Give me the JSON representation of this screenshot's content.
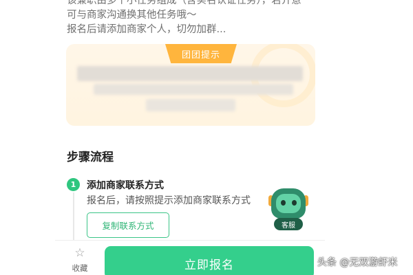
{
  "description": {
    "lines": [
      "该兼职由多个小任务组成（含实名认证任务），若介意",
      "可与商家沟通换其他任务哦～",
      "报名后请添加商家个人，切勿加群..."
    ]
  },
  "tip_card": {
    "tag_label": "团团提示"
  },
  "steps": {
    "title": "步骤流程",
    "items": [
      {
        "number": "1",
        "title": "添加商家联系方式",
        "description": "报名后，请按照提示添加商家联系方式",
        "button_label": "复制联系方式"
      }
    ]
  },
  "customer_service": {
    "label": "客服",
    "icon": "robot-mascot-icon"
  },
  "bottom_bar": {
    "favorite_label": "收藏",
    "favorite_icon": "star-outline-icon",
    "signup_label": "立即报名"
  },
  "watermark": {
    "text": "头条 @无双游虾米"
  },
  "colors": {
    "accent_green": "#34cf8c",
    "tip_orange": "#ffb53d",
    "tip_background": "#fff5e5"
  }
}
